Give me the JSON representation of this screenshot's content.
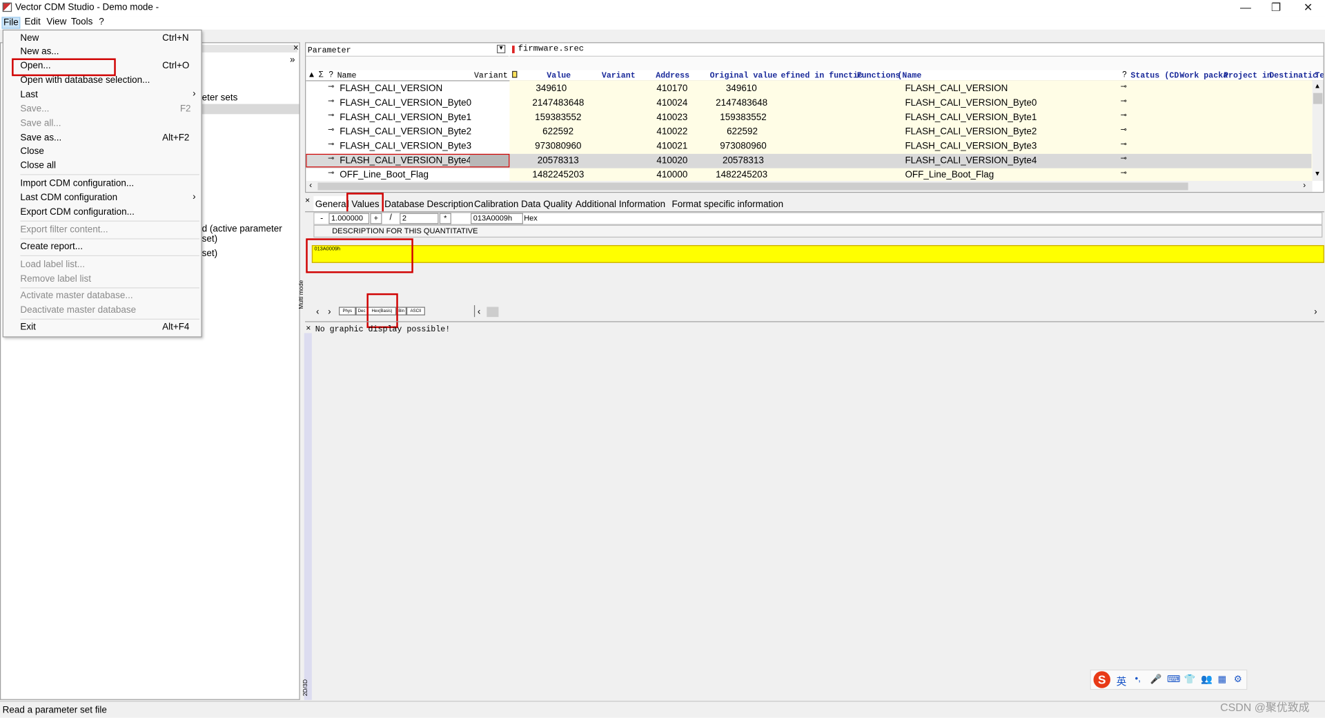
{
  "app": {
    "title": "Vector CDM Studio - Demo mode -",
    "window_controls": [
      "—",
      "❐",
      "✕"
    ]
  },
  "menubar": [
    "File",
    "Edit",
    "View",
    "Tools",
    "?"
  ],
  "file_menu": [
    {
      "label": "New",
      "shortcut": "Ctrl+N",
      "enabled": true
    },
    {
      "label": "New as...",
      "shortcut": "",
      "enabled": true
    },
    {
      "label": "Open...",
      "shortcut": "Ctrl+O",
      "enabled": true,
      "highlighted": true
    },
    {
      "label": "Open with database selection...",
      "shortcut": "",
      "enabled": true
    },
    {
      "label": "Last",
      "shortcut": "",
      "enabled": true,
      "submenu": true
    },
    {
      "label": "Save...",
      "shortcut": "F2",
      "enabled": false
    },
    {
      "label": "Save all...",
      "shortcut": "",
      "enabled": false
    },
    {
      "label": "Save as...",
      "shortcut": "Alt+F2",
      "enabled": true
    },
    {
      "label": "Close",
      "shortcut": "",
      "enabled": true
    },
    {
      "label": "Close all",
      "shortcut": "",
      "enabled": true
    },
    {
      "label": "Import CDM configuration...",
      "shortcut": "",
      "enabled": true
    },
    {
      "label": "Last CDM configuration",
      "shortcut": "",
      "enabled": true,
      "submenu": true
    },
    {
      "label": "Export CDM configuration...",
      "shortcut": "",
      "enabled": true
    },
    {
      "label": "Export filter content...",
      "shortcut": "",
      "enabled": false
    },
    {
      "label": "Create report...",
      "shortcut": "",
      "enabled": true
    },
    {
      "label": "Load label list...",
      "shortcut": "",
      "enabled": false
    },
    {
      "label": "Remove label list",
      "shortcut": "",
      "enabled": false
    },
    {
      "label": "Activate master database...",
      "shortcut": "",
      "enabled": false
    },
    {
      "label": "Deactivate master database",
      "shortcut": "",
      "enabled": false
    },
    {
      "label": "Exit",
      "shortcut": "Alt+F4",
      "enabled": true
    }
  ],
  "left_panel": {
    "close": "×",
    "expand": "»",
    "partial_text_1": "eter sets",
    "partial_text_2": "d (active parameter set)",
    "partial_text_3": "set)"
  },
  "param_table": {
    "filter_label": "Parameter",
    "file_tab": "firmware.srec",
    "headers_left": [
      "Name",
      "Variant"
    ],
    "header_icons": [
      "▲",
      "Σ",
      "?"
    ],
    "headers_right": [
      "Value",
      "Variant",
      "Address",
      "Original value",
      "efined in functic",
      "Functions",
      "(Name",
      "?",
      "Status",
      "(CD",
      "Work packa",
      "Project in",
      "Destinatic",
      "Te"
    ],
    "rows": [
      {
        "name": "FLASH_CALI_VERSION",
        "value": "349610",
        "address": "410170",
        "original": "349610",
        "fname": "FLASH_CALI_VERSION"
      },
      {
        "name": "FLASH_CALI_VERSION_Byte0",
        "value": "2147483648",
        "address": "410024",
        "original": "2147483648",
        "fname": "FLASH_CALI_VERSION_Byte0"
      },
      {
        "name": "FLASH_CALI_VERSION_Byte1",
        "value": "159383552",
        "address": "410023",
        "original": "159383552",
        "fname": "FLASH_CALI_VERSION_Byte1"
      },
      {
        "name": "FLASH_CALI_VERSION_Byte2",
        "value": "622592",
        "address": "410022",
        "original": "622592",
        "fname": "FLASH_CALI_VERSION_Byte2"
      },
      {
        "name": "FLASH_CALI_VERSION_Byte3",
        "value": "973080960",
        "address": "410021",
        "original": "973080960",
        "fname": "FLASH_CALI_VERSION_Byte3"
      },
      {
        "name": "FLASH_CALI_VERSION_Byte4",
        "value": "20578313",
        "address": "410020",
        "original": "20578313",
        "fname": "FLASH_CALI_VERSION_Byte4",
        "selected": true
      },
      {
        "name": "OFF_Line_Boot_Flag",
        "value": "1482245203",
        "address": "410000",
        "original": "1482245203",
        "fname": "OFF_Line_Boot_Flag"
      }
    ]
  },
  "detail_tabs": [
    "General",
    "Values",
    "Database Description",
    "Calibration Data Quality",
    "Additional Information",
    "Format specific information"
  ],
  "values_panel": {
    "minus": "-",
    "factor": "1.000000",
    "plus": "+",
    "divide": "/",
    "divisor": "2",
    "times": "*",
    "hex_value": "013A0009h",
    "format": "Hex",
    "description": "DESCRIPTION FOR THIS QUANTITATIVE",
    "cell_value": "013A0009h",
    "side_label": "Multi mode",
    "format_tabs": [
      "Phys",
      "Dec",
      "Hex(Basis)",
      "Bin",
      "ASCII"
    ]
  },
  "graphic_panel": {
    "message": "No graphic display possible!",
    "side_label": "2D/3D",
    "close": "×"
  },
  "status_bar": "Read a parameter set file",
  "watermark": "CSDN @聚优致成",
  "ime": {
    "mode": "英",
    "items": [
      "•,",
      "🎤",
      "⌨",
      "👕",
      "👥",
      "▦",
      "⚙"
    ]
  },
  "colors": {
    "yellow": "#ffff00",
    "highlight_box": "#d00000",
    "header_blue": "#1a2a9a"
  }
}
